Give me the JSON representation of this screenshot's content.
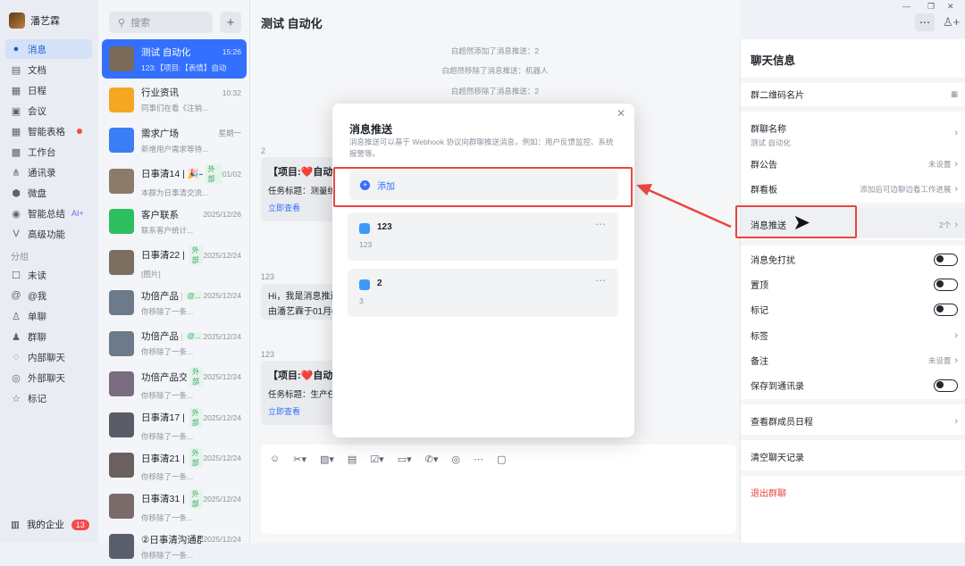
{
  "user": {
    "name": "潘艺霖"
  },
  "nav": {
    "items": [
      "消息",
      "文档",
      "日程",
      "会议",
      "智能表格",
      "工作台",
      "通讯录",
      "微盘",
      "智能总结",
      "高级功能"
    ],
    "ai_label": "AI+",
    "section": "分组",
    "groups": [
      "未读",
      "@我",
      "单聊",
      "群聊",
      "内部聊天",
      "外部聊天",
      "标记"
    ],
    "enterprise": "我的企业",
    "enterprise_badge": "13"
  },
  "search": {
    "placeholder": "搜索"
  },
  "conversations": [
    {
      "name": "测试 自动化",
      "preview": "123:【项目:【表情】自动化",
      "time": "15:26",
      "ext": ""
    },
    {
      "name": "行业资讯",
      "preview": "同事们在看《注销...",
      "time": "10:32",
      "ext": ""
    },
    {
      "name": "需求广场",
      "preview": "新增用户需求等待...",
      "time": "星期一",
      "ext": ""
    },
    {
      "name": "日事清14 | 🎉—...",
      "preview": "本群为日事清交流...",
      "time": "01/02",
      "ext": "外部"
    },
    {
      "name": "客户联系",
      "preview": "联系客户统计...",
      "time": "2025/12/26",
      "ext": ""
    },
    {
      "name": "日事清22 | 🎉—...",
      "preview": "[图片]",
      "time": "2025/12/24",
      "ext": "外部"
    },
    {
      "name": "功倍产品 | 课程&...",
      "preview": "你移除了一条...",
      "time": "2025/12/24",
      "ext": "@..."
    },
    {
      "name": "功倍产品 | 课程&...",
      "preview": "你移除了一条...",
      "time": "2025/12/24",
      "ext": "@..."
    },
    {
      "name": "功倍产品交流群n...",
      "preview": "你移除了一条...",
      "time": "2025/12/24",
      "ext": "外部"
    },
    {
      "name": "日事清17 | 🎉—...",
      "preview": "你移除了一条...",
      "time": "2025/12/24",
      "ext": "外部"
    },
    {
      "name": "日事清21 | 🎉—...",
      "preview": "你移除了一条...",
      "time": "2025/12/24",
      "ext": "外部"
    },
    {
      "name": "日事清31 | 🎉—...",
      "preview": "你移除了一条...",
      "time": "2025/12/24",
      "ext": "外部"
    },
    {
      "name": "②日事清沟通群 | 🎉...",
      "preview": "你移除了一条...",
      "time": "2025/12/24",
      "ext": ""
    }
  ],
  "chat": {
    "title": "测试 自动化",
    "system": [
      "白超然添加了消息推送：2",
      "白超然移除了消息推送：机器人",
      "白超然移除了消息推送：2"
    ],
    "msg1": {
      "sender": "2",
      "title": "【项目:❤️自动化",
      "sub": "任务标题：测量统",
      "link": "立即查看"
    },
    "msg2": {
      "sender": "123",
      "line1": "Hi，我是消息推送",
      "line2": "由潘艺霖于01月05"
    },
    "msg3": {
      "sender": "123",
      "title": "【项目:❤️自动",
      "sub": "任务标题：生产任",
      "link": "立即查看"
    }
  },
  "dialog": {
    "title": "消息推送",
    "desc": "消息推送可以基于 Webhook 协议向群聊推送消息，例如：用户反馈监控、系统报警等。",
    "add_label": "添加",
    "cards": [
      {
        "name": "123",
        "sub": "123"
      },
      {
        "name": "2",
        "sub": "3"
      }
    ]
  },
  "side": {
    "title": "聊天信息",
    "qr": "群二维码名片",
    "group_name_label": "群聊名称",
    "group_name_value": "测试 自动化",
    "announcement": "群公告",
    "announcement_value": "未设置",
    "board": "群看板",
    "board_value": "添加后可边聊边看工作进展",
    "push": "消息推送",
    "push_value": "2个",
    "dnd": "消息免打扰",
    "pin": "置顶",
    "mark": "标记",
    "tag": "标签",
    "remark": "备注",
    "remark_value": "未设置",
    "save_contacts": "保存到通讯录",
    "view_schedule": "查看群成员日程",
    "clear_history": "清空聊天记录",
    "quit": "退出群聊"
  },
  "colors": {
    "accent": "#3370ff",
    "highlight": "#e8463e",
    "danger": "#e8463e"
  }
}
